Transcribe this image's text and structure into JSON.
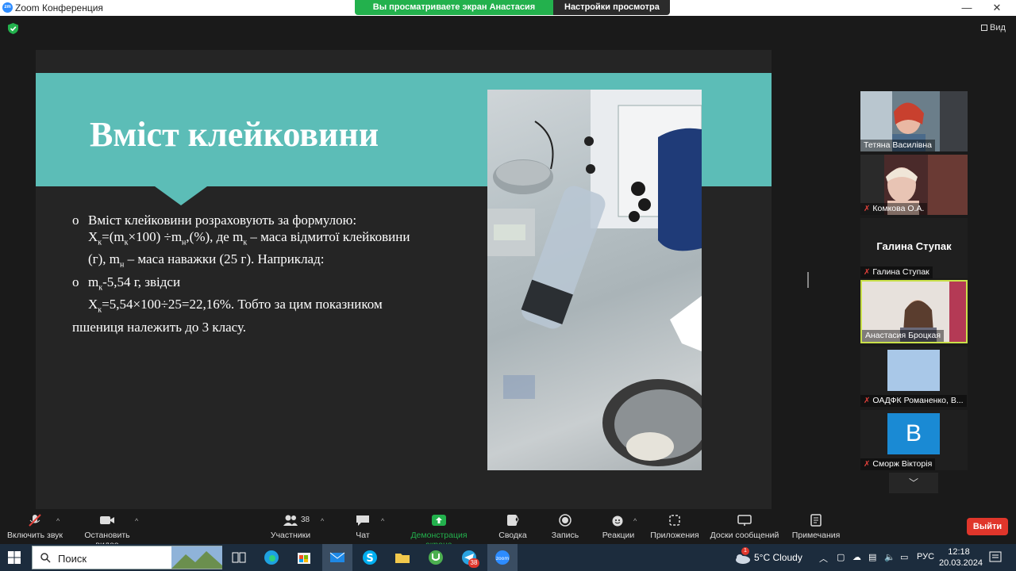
{
  "window": {
    "app_icon_text": "zm",
    "title": "Zoom Конференция",
    "minimize": "—",
    "restore": "❐",
    "close": "✕"
  },
  "share_banner": {
    "viewing": "Вы просматриваете экран Анастасия Броцкая",
    "settings": "Настройки просмотра",
    "settings_caret": "▾"
  },
  "view_button": "Вид",
  "slide": {
    "title": "Вміст клейковини",
    "bullet_marker": "o",
    "b1_line1": "Вміст клейковини розраховують за формулою:",
    "b1_line2_a": "X",
    "b1_line2_sub1": "к",
    "b1_line2_b": "=(m",
    "b1_line2_sub2": "к",
    "b1_line2_c": "×100) ÷m",
    "b1_line2_sub3": "н",
    "b1_line2_d": ",(%), де m",
    "b1_line2_sub4": "к",
    "b1_line2_e": " – маса відмитої клейковини",
    "b1_line3_a": "(г), m",
    "b1_line3_sub": "н",
    "b1_line3_b": " – маса наважки (25 г). Наприклад:",
    "b2_line1_a": "m",
    "b2_line1_sub": "к",
    "b2_line1_b": "-5,54 г, звідси",
    "b2_line2_a": "X",
    "b2_line2_sub": "к",
    "b2_line2_b": "=5,54×100÷25=22,16%. Тобто за цим показником",
    "b2_line3": "пшениця належить до 3 класу."
  },
  "participants": [
    {
      "name": "Тетяна Василівна",
      "muted": false
    },
    {
      "name": "Комкова О.А.",
      "muted": true
    },
    {
      "name": "Галина Ступак",
      "muted": true,
      "display": "Галина Ступак"
    },
    {
      "name": "Анастасия Броцкая",
      "muted": false
    },
    {
      "name": "ОАДФК Романенко, В...",
      "muted": true
    },
    {
      "name": "Сморж Вікторія",
      "muted": true,
      "avatar_letter": "В"
    }
  ],
  "toolbar": {
    "audio": "Включить звук",
    "video": "Остановить видео",
    "participants": "Участники",
    "participants_count": "38",
    "chat": "Чат",
    "share": "Демонстрация экрана",
    "summary": "Сводка",
    "record": "Запись",
    "reactions": "Реакции",
    "apps": "Приложения",
    "whiteboards": "Доски сообщений",
    "notes": "Примечания",
    "leave": "Выйти"
  },
  "taskbar": {
    "search_placeholder": "Поиск",
    "weather": "5°C  Cloudy",
    "weather_badge": "1",
    "language": "РУС",
    "time": "12:18",
    "date": "20.03.2024",
    "telegram_badge": "38"
  },
  "colors": {
    "teal": "#5cbdb7",
    "zoom_green": "#23b14d",
    "leave_red": "#e0362b",
    "active_speaker": "#c9e04a",
    "avatar_blue": "#1a8ad4"
  }
}
